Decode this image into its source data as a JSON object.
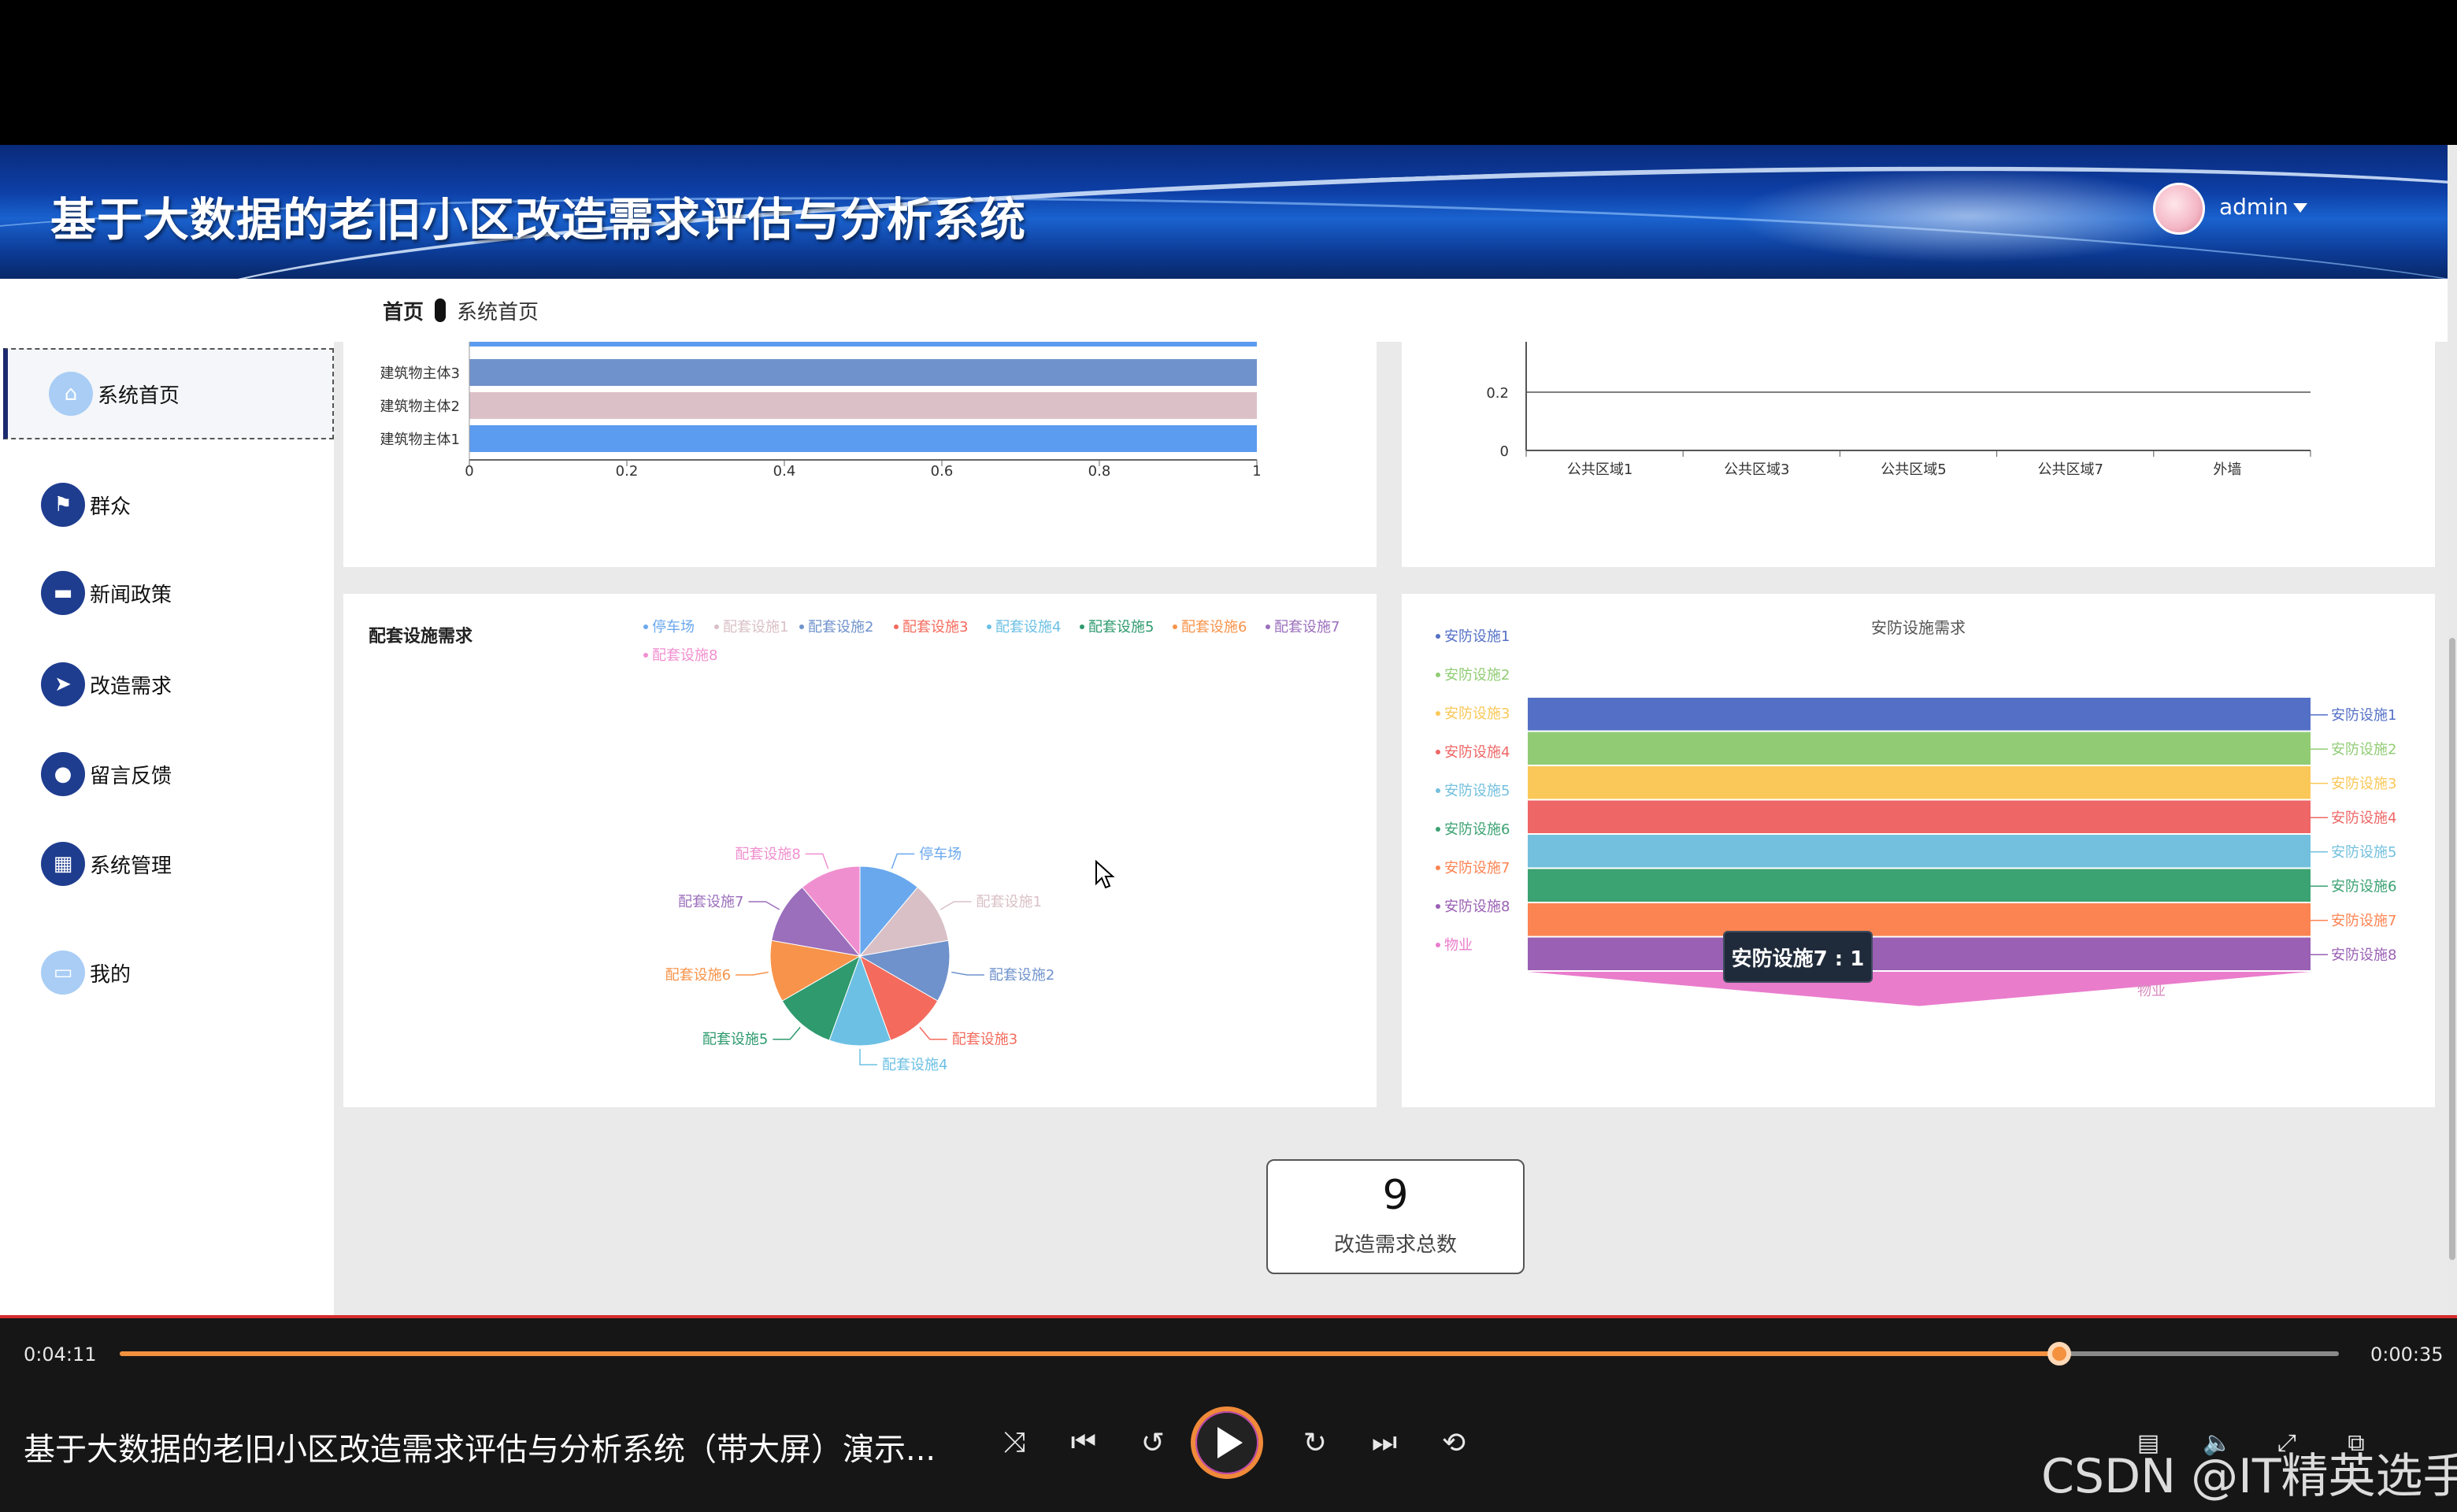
{
  "app": {
    "title": "基于大数据的老旧小区改造需求评估与分析系统",
    "user": "admin"
  },
  "breadcrumb": {
    "home": "首页",
    "current": "系统首页"
  },
  "sidebar": {
    "items": [
      {
        "label": "系统首页",
        "icon": "home-icon"
      },
      {
        "label": "群众",
        "icon": "flag-icon"
      },
      {
        "label": "新闻政策",
        "icon": "monitor-icon"
      },
      {
        "label": "改造需求",
        "icon": "send-icon"
      },
      {
        "label": "留言反馈",
        "icon": "bulb-icon"
      },
      {
        "label": "系统管理",
        "icon": "grid-icon"
      },
      {
        "label": "我的",
        "icon": "card-icon"
      }
    ]
  },
  "chart_data": [
    {
      "type": "bar",
      "orientation": "horizontal",
      "categories": [
        "建筑物主体1",
        "建筑物主体2",
        "建筑物主体3"
      ],
      "values": [
        1,
        1,
        1
      ],
      "xticks": [
        "0",
        "0.2",
        "0.4",
        "0.6",
        "0.8",
        "1"
      ],
      "xlim": [
        0,
        1
      ],
      "colors": [
        "#5b9bf0",
        "#dcc0c8",
        "#6f92cc",
        "#5b9bf0"
      ]
    },
    {
      "type": "line",
      "categories": [
        "公共区域1",
        "公共区域3",
        "公共区域5",
        "公共区域7",
        "外墙"
      ],
      "yticks": [
        "0",
        "0.2"
      ],
      "ylim": [
        0,
        0.2
      ]
    },
    {
      "type": "pie",
      "title": "配套设施需求",
      "legend": [
        "停车场",
        "配套设施1",
        "配套设施2",
        "配套设施3",
        "配套设施4",
        "配套设施5",
        "配套设施6",
        "配套设施7",
        "配套设施8"
      ],
      "values": [
        1,
        1,
        1,
        1,
        1,
        1,
        1,
        1,
        1
      ],
      "colors": [
        "#6aa8ee",
        "#d9c0c6",
        "#6f92cc",
        "#f46b5d",
        "#6cc0e4",
        "#2e9a6e",
        "#f7934a",
        "#9b6fbc",
        "#f08fcf"
      ]
    },
    {
      "type": "funnel",
      "title": "安防设施需求",
      "legend": [
        "安防设施1",
        "安防设施2",
        "安防设施3",
        "安防设施4",
        "安防设施5",
        "安防设施6",
        "安防设施7",
        "安防设施8",
        "物业"
      ],
      "values": [
        1,
        1,
        1,
        1,
        1,
        1,
        1,
        1,
        1
      ],
      "colors": [
        "#5470c6",
        "#91cc75",
        "#fac858",
        "#ee6666",
        "#73c0de",
        "#3ba272",
        "#fc8452",
        "#9a60b4",
        "#ea7ccc"
      ],
      "tooltip": "安防设施7 : 1",
      "overlay_label": "物业"
    }
  ],
  "stat": {
    "value": "9",
    "label": "改造需求总数"
  },
  "player": {
    "current_time": "0:04:11",
    "total_time": "0:00:35",
    "progress": 0.873,
    "video_title": "基于大数据的老旧小区改造需求评估与分析系统（带大屏）演示...",
    "watermark": "CSDN @IT精英选手"
  }
}
